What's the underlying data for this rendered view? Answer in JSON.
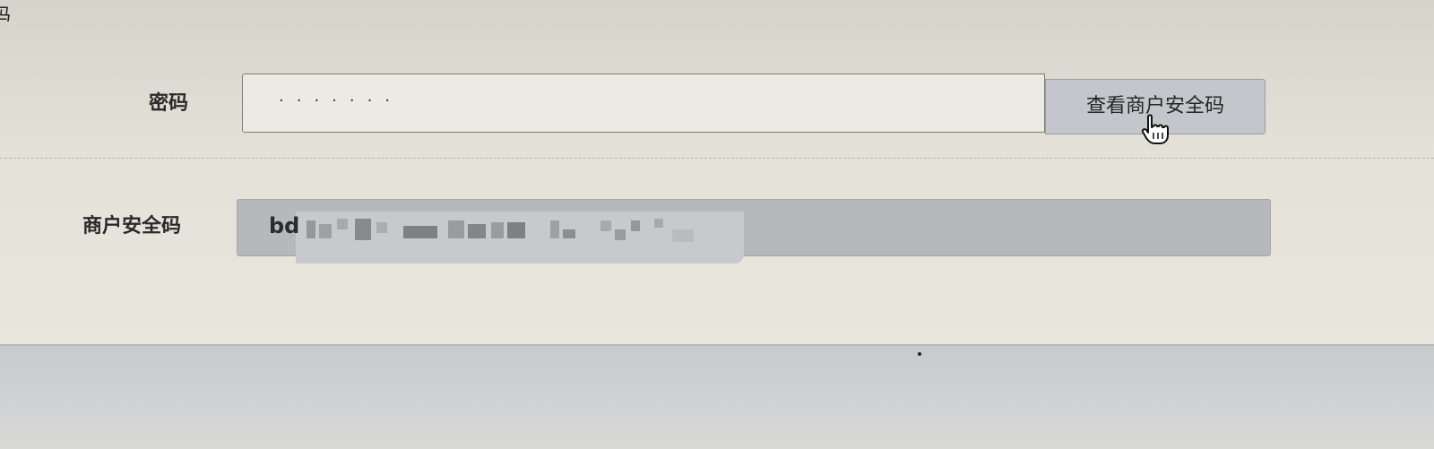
{
  "form": {
    "password_label": "密码",
    "password_value": "·······",
    "view_button_label": "查看商户安全码",
    "merchant_code_label": "商户安全码",
    "merchant_code_visible_prefix": "bd"
  },
  "icons": {
    "cursor": "hand-pointer-icon"
  }
}
